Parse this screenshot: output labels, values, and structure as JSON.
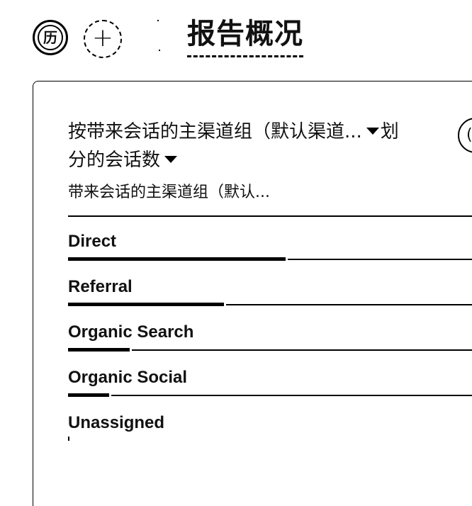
{
  "header": {
    "badge_glyph": "历",
    "add_glyph": "+",
    "title": "报告概况"
  },
  "card": {
    "title_part1": "按带来会话的主渠道组（默认渠道...",
    "title_part2": "划",
    "title_part3": "分的会话数",
    "column_header": "带来会话的主渠道组（默认...",
    "side_button_glyph": "("
  },
  "rows": [
    {
      "label": "Direct",
      "share": 0.53
    },
    {
      "label": "Referral",
      "share": 0.38
    },
    {
      "label": "Organic Search",
      "share": 0.15
    },
    {
      "label": "Organic Social",
      "share": 0.1
    },
    {
      "label": "Unassigned",
      "share": 0.005
    }
  ]
}
